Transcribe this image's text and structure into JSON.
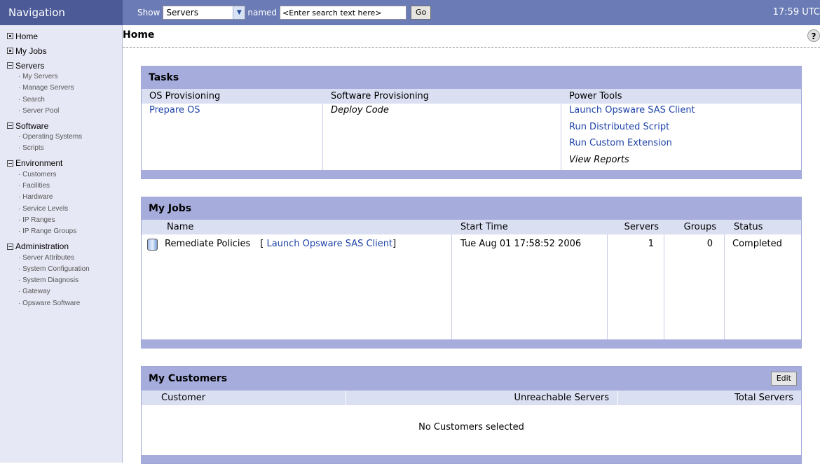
{
  "nav": {
    "title": "Navigation",
    "items": [
      {
        "label": "Home",
        "marker": "filled",
        "sub": []
      },
      {
        "label": "My Jobs",
        "marker": "filled",
        "sub": []
      },
      {
        "label": "Servers",
        "marker": "minus",
        "sub": [
          "My Servers",
          "Manage Servers",
          "Search",
          "Server Pool"
        ]
      },
      {
        "label": "Software",
        "marker": "minus",
        "sub": [
          "Operating Systems",
          "Scripts"
        ]
      },
      {
        "label": "Environment",
        "marker": "minus",
        "sub": [
          "Customers",
          "Facilities",
          "Hardware",
          "Service Levels",
          "IP Ranges",
          "IP Range Groups"
        ]
      },
      {
        "label": "Administration",
        "marker": "minus",
        "sub": [
          "Server Attributes",
          "System Configuration",
          "System Diagnosis",
          "Gateway",
          "Opsware Software"
        ]
      }
    ]
  },
  "search": {
    "show_label": "Show",
    "type_value": "Servers",
    "named_label": "named",
    "placeholder": "<Enter search text here>",
    "go_label": "Go"
  },
  "clock": "17:59 UTC",
  "page": {
    "title": "Home",
    "help_label": "?"
  },
  "tasks": {
    "title": "Tasks",
    "columns": [
      {
        "header": "OS Provisioning",
        "items": [
          {
            "label": "Prepare OS",
            "style": "link"
          }
        ]
      },
      {
        "header": "Software Provisioning",
        "items": [
          {
            "label": "Deploy Code",
            "style": "italic"
          }
        ]
      },
      {
        "header": "Power Tools",
        "items": [
          {
            "label": "Launch Opsware SAS Client",
            "style": "link"
          },
          {
            "label": "Run Distributed Script",
            "style": "link"
          },
          {
            "label": "Run Custom Extension",
            "style": "link"
          },
          {
            "label": "View Reports",
            "style": "italic"
          }
        ]
      }
    ]
  },
  "jobs": {
    "title": "My Jobs",
    "headers": {
      "name": "Name",
      "start": "Start Time",
      "servers": "Servers",
      "groups": "Groups",
      "status": "Status"
    },
    "rows": [
      {
        "name": "Remediate Policies",
        "link_open": "[ ",
        "link": "Launch Opsware SAS Client",
        "link_close": "]",
        "start": "Tue Aug 01 17:58:52 2006",
        "servers": "1",
        "groups": "0",
        "status": "Completed"
      }
    ]
  },
  "customers": {
    "title": "My Customers",
    "edit_label": "Edit",
    "headers": {
      "customer": "Customer",
      "unreachable": "Unreachable Servers",
      "total": "Total Servers"
    },
    "empty_message": "No Customers selected"
  },
  "colors": {
    "nav_header": "#4c5a97",
    "topbar": "#6a7bb5",
    "sidebar": "#e7e8f5",
    "panel_header": "#a6addd",
    "column_header": "#dadff2",
    "link": "#1f44a8"
  }
}
